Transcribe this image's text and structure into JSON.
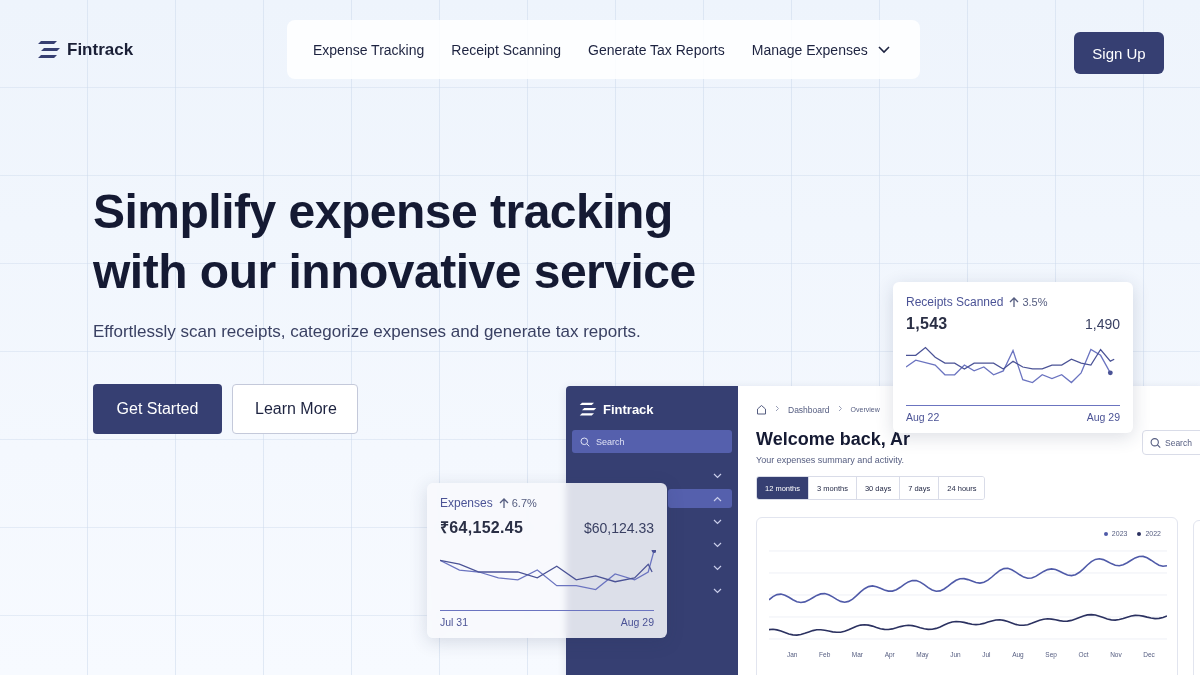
{
  "brand": {
    "name": "Fintrack"
  },
  "nav": {
    "links": [
      {
        "label": "Expense Tracking",
        "has_menu": false
      },
      {
        "label": "Receipt Scanning",
        "has_menu": false
      },
      {
        "label": "Generate Tax Reports",
        "has_menu": false
      },
      {
        "label": "Manage Expenses",
        "has_menu": true
      }
    ]
  },
  "signup_button": "Sign Up",
  "hero": {
    "title_lines": [
      "Simplify expense tracking",
      "with our innovative service"
    ],
    "subtitle": "Effortlessly scan receipts, categorize expenses and generate tax reports.",
    "buttons": [
      {
        "label": "Get Started",
        "kind": "primary"
      },
      {
        "label": "Learn More",
        "kind": "secondary"
      }
    ]
  },
  "app_preview": {
    "brand": "Fintrack",
    "sidebar_search": {
      "placeholder": "Search"
    },
    "sidebar_items": [
      {
        "selected": false,
        "expanded": false
      },
      {
        "selected": true,
        "expanded": true
      },
      {
        "selected": false,
        "expanded": false
      },
      {
        "selected": false,
        "expanded": false
      },
      {
        "selected": false,
        "expanded": false
      },
      {
        "selected": false,
        "expanded": false
      }
    ],
    "breadcrumb": [
      "Dashboard",
      "Overview"
    ],
    "heading": "Welcome back, Ar",
    "subheading": "Your expenses summary and activity.",
    "search": {
      "placeholder": "Search"
    },
    "ranges": [
      {
        "label": "12 months",
        "selected": true
      },
      {
        "label": "3 months",
        "selected": false
      },
      {
        "label": "30 days",
        "selected": false
      },
      {
        "label": "7 days",
        "selected": false
      },
      {
        "label": "24 hours",
        "selected": false
      }
    ],
    "chart": {
      "legend": [
        {
          "label": "2023",
          "color": "#4f5aa8"
        },
        {
          "label": "2022",
          "color": "#2b3160"
        }
      ],
      "months": [
        "Jan",
        "Feb",
        "Mar",
        "Apr",
        "May",
        "Jun",
        "Jul",
        "Aug",
        "Sep",
        "Oct",
        "Nov",
        "Dec"
      ]
    }
  },
  "cards": [
    {
      "title": "Receipts Scanned",
      "change": "3.5%",
      "value": "1,543",
      "compare": "1,490",
      "start": "Aug 22",
      "end": "Aug 29"
    },
    {
      "title": "Expenses",
      "change": "6.7%",
      "value": "₹64,152.45",
      "compare": "$60,124.33",
      "start": "Jul 31",
      "end": "Aug 29"
    }
  ]
}
